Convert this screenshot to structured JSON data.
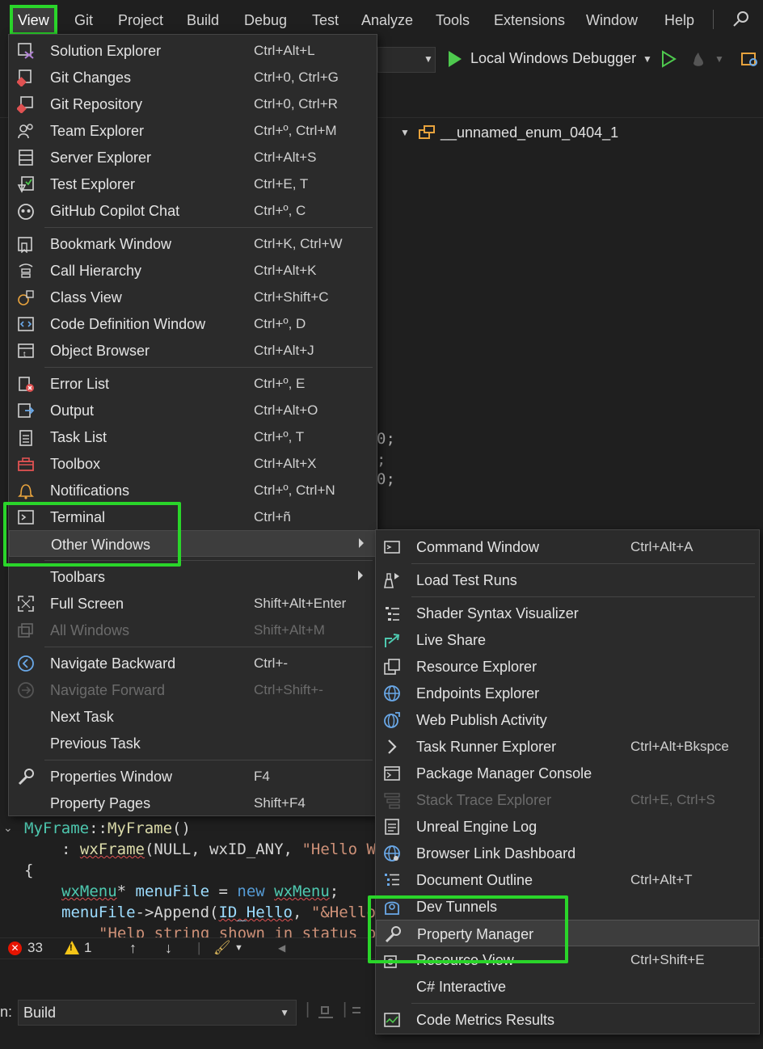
{
  "menubar": {
    "items": [
      "View",
      "Git",
      "Project",
      "Build",
      "Debug",
      "Test",
      "Analyze",
      "Tools",
      "Extensions",
      "Window",
      "Help"
    ]
  },
  "toolbar": {
    "debugger_label": "Local Windows Debugger"
  },
  "navbar": {
    "symbol": "__unnamed_enum_0404_1"
  },
  "code": {
    "frag1": "0;",
    "frag2": ";",
    "frag3": "0;",
    "line1": [
      "MyFrame",
      "::",
      "MyFrame",
      "()"
    ],
    "line2": [
      ": ",
      "wxFrame",
      "(NULL, wxID_ANY, ",
      "\"Hello W"
    ],
    "line3": "{",
    "line4": [
      "wxMenu",
      "* ",
      "menuFile",
      " = ",
      "new",
      " ",
      "wxMenu",
      ";"
    ],
    "line5": [
      "menuFile",
      "->Append(",
      "ID_Hello",
      ", ",
      "\"&Hello"
    ],
    "line6": "\"Help string shown in status b"
  },
  "errors": {
    "error_count": "33",
    "warning_count": "1"
  },
  "output": {
    "label": "n:",
    "source": "Build"
  },
  "view_menu": {
    "items": [
      {
        "label": "Solution Explorer",
        "shortcut": "Ctrl+Alt+L",
        "icon": "solution-explorer-icon"
      },
      {
        "label": "Git Changes",
        "shortcut": "Ctrl+0, Ctrl+G",
        "icon": "git-changes-icon"
      },
      {
        "label": "Git Repository",
        "shortcut": "Ctrl+0, Ctrl+R",
        "icon": "git-repository-icon"
      },
      {
        "label": "Team Explorer",
        "shortcut": "Ctrl+º, Ctrl+M",
        "icon": "team-explorer-icon"
      },
      {
        "label": "Server Explorer",
        "shortcut": "Ctrl+Alt+S",
        "icon": "server-explorer-icon"
      },
      {
        "label": "Test Explorer",
        "shortcut": "Ctrl+E, T",
        "icon": "test-explorer-icon"
      },
      {
        "label": "GitHub Copilot Chat",
        "shortcut": "Ctrl+º, C",
        "icon": "copilot-icon"
      },
      {
        "label": "Bookmark Window",
        "shortcut": "Ctrl+K, Ctrl+W",
        "icon": "bookmark-icon"
      },
      {
        "label": "Call Hierarchy",
        "shortcut": "Ctrl+Alt+K",
        "icon": "call-hierarchy-icon"
      },
      {
        "label": "Class View",
        "shortcut": "Ctrl+Shift+C",
        "icon": "class-view-icon"
      },
      {
        "label": "Code Definition Window",
        "shortcut": "Ctrl+º, D",
        "icon": "code-definition-icon"
      },
      {
        "label": "Object Browser",
        "shortcut": "Ctrl+Alt+J",
        "icon": "object-browser-icon"
      },
      {
        "label": "Error List",
        "shortcut": "Ctrl+º, E",
        "icon": "error-list-icon"
      },
      {
        "label": "Output",
        "shortcut": "Ctrl+Alt+O",
        "icon": "output-icon"
      },
      {
        "label": "Task List",
        "shortcut": "Ctrl+º, T",
        "icon": "task-list-icon"
      },
      {
        "label": "Toolbox",
        "shortcut": "Ctrl+Alt+X",
        "icon": "toolbox-icon"
      },
      {
        "label": "Notifications",
        "shortcut": "Ctrl+º, Ctrl+N",
        "icon": "bell-icon"
      },
      {
        "label": "Terminal",
        "shortcut": "Ctrl+ñ",
        "icon": "terminal-icon"
      },
      {
        "label": "Other Windows",
        "shortcut": "",
        "icon": ""
      },
      {
        "label": "Toolbars",
        "shortcut": "",
        "icon": ""
      },
      {
        "label": "Full Screen",
        "shortcut": "Shift+Alt+Enter",
        "icon": "full-screen-icon"
      },
      {
        "label": "All Windows",
        "shortcut": "Shift+Alt+M",
        "icon": "all-windows-icon"
      },
      {
        "label": "Navigate Backward",
        "shortcut": "Ctrl+-",
        "icon": "navigate-backward-icon"
      },
      {
        "label": "Navigate Forward",
        "shortcut": "Ctrl+Shift+-",
        "icon": "navigate-forward-icon"
      },
      {
        "label": "Next Task",
        "shortcut": "",
        "icon": ""
      },
      {
        "label": "Previous Task",
        "shortcut": "",
        "icon": ""
      },
      {
        "label": "Properties Window",
        "shortcut": "F4",
        "icon": "wrench-icon"
      },
      {
        "label": "Property Pages",
        "shortcut": "Shift+F4",
        "icon": ""
      }
    ]
  },
  "other_windows_menu": {
    "items": [
      {
        "label": "Command Window",
        "shortcut": "Ctrl+Alt+A",
        "icon": "command-window-icon"
      },
      {
        "label": "Load Test Runs",
        "shortcut": "",
        "icon": "load-test-icon"
      },
      {
        "label": "Shader Syntax Visualizer",
        "shortcut": "",
        "icon": "shader-syntax-icon"
      },
      {
        "label": "Live Share",
        "shortcut": "",
        "icon": "live-share-icon"
      },
      {
        "label": "Resource Explorer",
        "shortcut": "",
        "icon": "resource-explorer-icon"
      },
      {
        "label": "Endpoints Explorer",
        "shortcut": "",
        "icon": "endpoints-icon"
      },
      {
        "label": "Web Publish Activity",
        "shortcut": "",
        "icon": "web-publish-icon"
      },
      {
        "label": "Task Runner Explorer",
        "shortcut": "Ctrl+Alt+Bkspce",
        "icon": "chevron-right-icon"
      },
      {
        "label": "Package Manager Console",
        "shortcut": "",
        "icon": "package-console-icon"
      },
      {
        "label": "Stack Trace Explorer",
        "shortcut": "Ctrl+E, Ctrl+S",
        "icon": "stack-trace-icon"
      },
      {
        "label": "Unreal Engine Log",
        "shortcut": "",
        "icon": "unreal-log-icon"
      },
      {
        "label": "Browser Link Dashboard",
        "shortcut": "",
        "icon": "browser-link-icon"
      },
      {
        "label": "Document Outline",
        "shortcut": "Ctrl+Alt+T",
        "icon": "document-outline-icon"
      },
      {
        "label": "Dev Tunnels",
        "shortcut": "",
        "icon": "dev-tunnels-icon"
      },
      {
        "label": "Property Manager",
        "shortcut": "",
        "icon": "wrench-icon"
      },
      {
        "label": "Resource View",
        "shortcut": "Ctrl+Shift+E",
        "icon": "resource-view-icon"
      },
      {
        "label": "C# Interactive",
        "shortcut": "",
        "icon": ""
      },
      {
        "label": "Code Metrics Results",
        "shortcut": "",
        "icon": "code-metrics-icon"
      }
    ]
  },
  "colors": {
    "highlight_callout": "#2ad52a",
    "menu_bg": "#2b2b2b",
    "editor_bg": "#1f1f1f"
  }
}
